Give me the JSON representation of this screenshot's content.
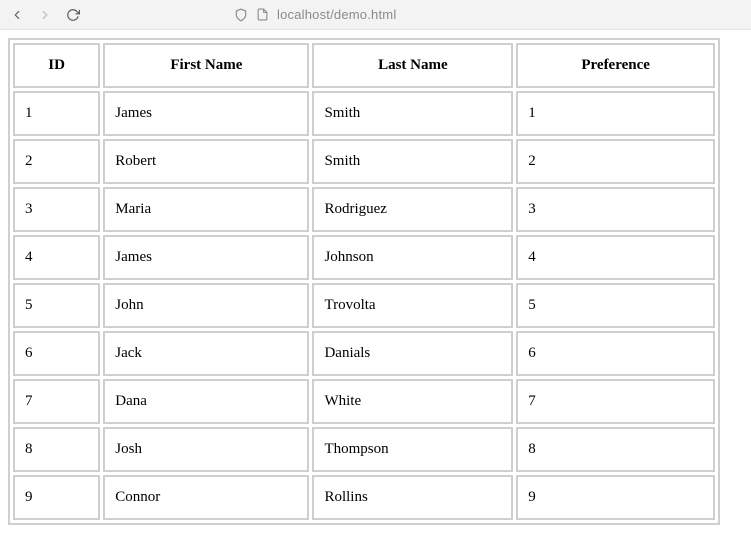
{
  "browser": {
    "url": "localhost/demo.html"
  },
  "table": {
    "headers": [
      "ID",
      "First Name",
      "Last Name",
      "Preference"
    ],
    "rows": [
      {
        "id": "1",
        "first": "James",
        "last": "Smith",
        "pref": "1"
      },
      {
        "id": "2",
        "first": "Robert",
        "last": "Smith",
        "pref": "2"
      },
      {
        "id": "3",
        "first": "Maria",
        "last": "Rodriguez",
        "pref": "3"
      },
      {
        "id": "4",
        "first": "James",
        "last": "Johnson",
        "pref": "4"
      },
      {
        "id": "5",
        "first": "John",
        "last": "Trovolta",
        "pref": "5"
      },
      {
        "id": "6",
        "first": "Jack",
        "last": "Danials",
        "pref": "6"
      },
      {
        "id": "7",
        "first": "Dana",
        "last": "White",
        "pref": "7"
      },
      {
        "id": "8",
        "first": "Josh",
        "last": "Thompson",
        "pref": "8"
      },
      {
        "id": "9",
        "first": "Connor",
        "last": "Rollins",
        "pref": "9"
      }
    ]
  }
}
